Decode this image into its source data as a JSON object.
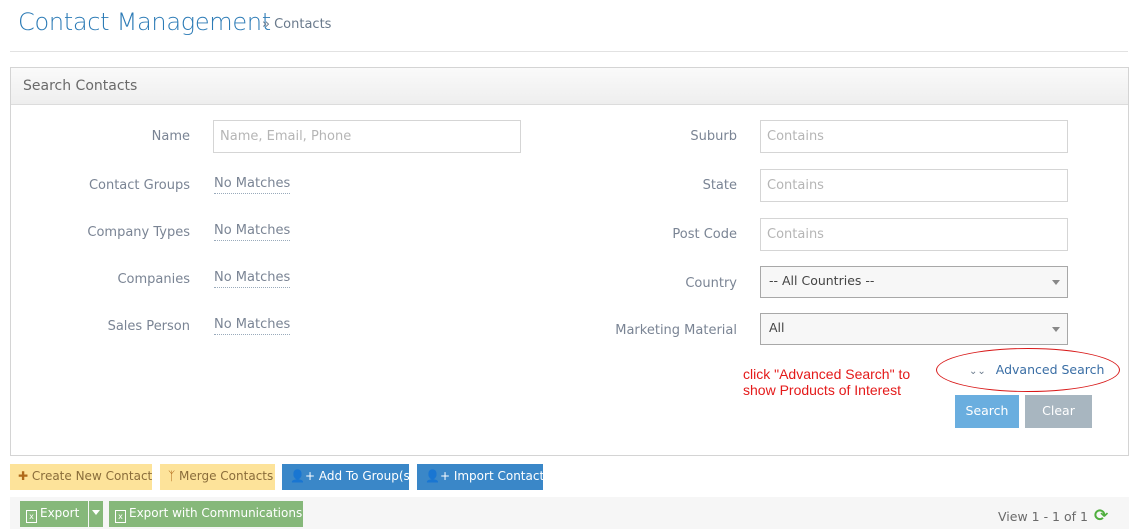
{
  "header": {
    "title": "Contact Management",
    "breadcrumb": "» Contacts"
  },
  "search_panel": {
    "title": "Search Contacts",
    "left_fields": [
      {
        "label": "Name",
        "placeholder": "Name, Email, Phone",
        "value": ""
      },
      {
        "label": "Contact Groups",
        "value": "No Matches"
      },
      {
        "label": "Company Types",
        "value": "No Matches"
      },
      {
        "label": "Companies",
        "value": "No Matches"
      },
      {
        "label": "Sales Person",
        "value": "No Matches"
      }
    ],
    "right_fields": [
      {
        "label": "Suburb",
        "placeholder": "Contains",
        "value": ""
      },
      {
        "label": "State",
        "placeholder": "Contains",
        "value": ""
      },
      {
        "label": "Post Code",
        "placeholder": "Contains",
        "value": ""
      },
      {
        "label": "Country",
        "selected": "-- All Countries --"
      },
      {
        "label": "Marketing Material",
        "selected": "All"
      }
    ],
    "advanced_search_label": "Advanced Search",
    "annotation": {
      "line1": "click \"Advanced Search\" to",
      "line2": "show Products of Interest",
      "color": "#e41a1a"
    },
    "search_button": "Search",
    "clear_button": "Clear"
  },
  "toolbar": {
    "create_new_contact": "Create New Contact",
    "merge_contacts": "Merge Contacts",
    "add_to_groups": "Add To Group(s)",
    "import_contacts": "Import Contacts",
    "export": "Export",
    "export_with_communications": "Export with Communications"
  },
  "pager": {
    "text": "View 1 - 1 of 1"
  },
  "colors": {
    "title_blue": "#2c7bb6",
    "yellow_button": "#fde39a",
    "blue_button": "#3a87c8",
    "green_button": "#86b87a",
    "search_button": "#6aaedf",
    "clear_button": "#a8b6c0"
  }
}
